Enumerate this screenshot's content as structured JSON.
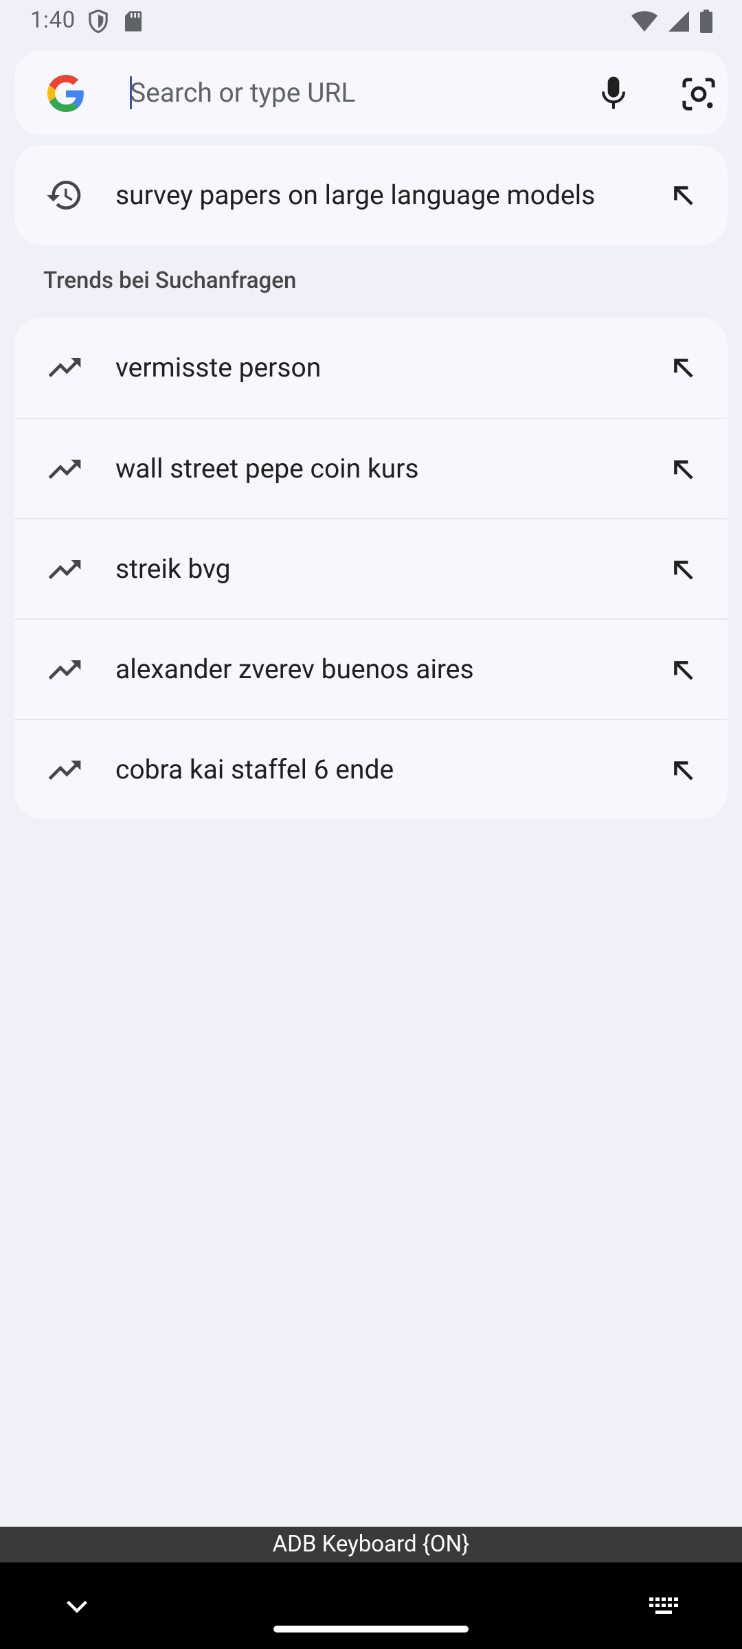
{
  "status": {
    "time": "1:40",
    "left_icons": [
      "shield-icon",
      "sd-card-icon"
    ],
    "right_icons": [
      "wifi-icon",
      "signal-icon",
      "battery-icon"
    ]
  },
  "search": {
    "placeholder": "Search or type URL",
    "value": ""
  },
  "history": {
    "items": [
      {
        "icon": "history-icon",
        "text": "survey papers on large language models"
      }
    ]
  },
  "trends": {
    "header": "Trends bei Suchanfragen",
    "items": [
      {
        "icon": "trending-icon",
        "text": "vermisste person"
      },
      {
        "icon": "trending-icon",
        "text": "wall street pepe coin kurs"
      },
      {
        "icon": "trending-icon",
        "text": "streik bvg"
      },
      {
        "icon": "trending-icon",
        "text": "alexander zverev buenos aires"
      },
      {
        "icon": "trending-icon",
        "text": "cobra kai staffel 6 ende"
      }
    ]
  },
  "keyboard_bar": {
    "label": "ADB Keyboard {ON}"
  },
  "colors": {
    "background": "#eff0f8",
    "card": "#f7f7fd",
    "text": "#1f1f1f",
    "caret": "#3f51b5"
  }
}
